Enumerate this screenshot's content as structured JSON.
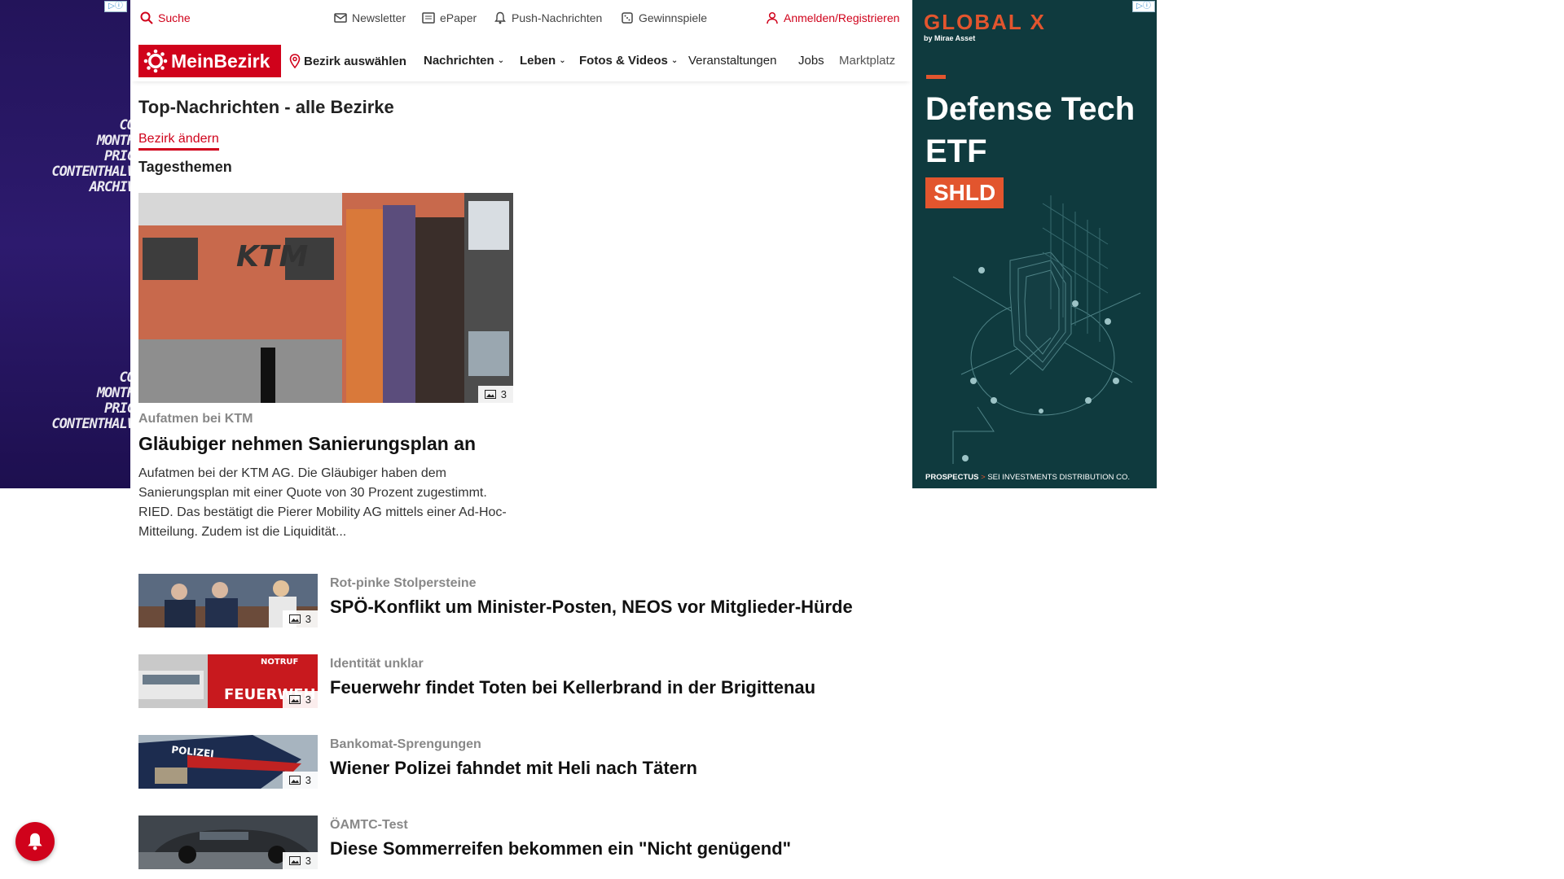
{
  "util_bar": {
    "search": "Suche",
    "newsletter": "Newsletter",
    "epaper": "ePaper",
    "push": "Push-Nachrichten",
    "contests": "Gewinnspiele",
    "login": "Anmelden/Registrieren"
  },
  "nav": {
    "logo": "MeinBezirk",
    "district": "Bezirk auswählen",
    "items": [
      {
        "label": "Nachrichten",
        "dropdown": true
      },
      {
        "label": "Leben",
        "dropdown": true
      },
      {
        "label": "Fotos & Videos",
        "dropdown": true
      },
      {
        "label": "Veranstaltungen",
        "dropdown": false
      },
      {
        "label": "Jobs",
        "dropdown": false
      },
      {
        "label": "Marktplatz",
        "dropdown": false
      }
    ]
  },
  "page": {
    "title": "Top-Nachrichten - alle Bezirke",
    "change_district": "Bezirk ändern",
    "section": "Tagesthemen"
  },
  "lead": {
    "kicker": "Aufatmen bei KTM",
    "headline": "Gläubiger nehmen Sanierungsplan an",
    "teaser": "Aufatmen bei der KTM AG. Die Gläubiger haben dem Sanierungsplan mit einer Quote von 30 Prozent zugestimmt. RIED. Das bestätigt die Pierer Mobility AG mittels einer Ad-Hoc-Mitteilung. Zudem ist die Liquidität...",
    "image_count": "3"
  },
  "articles": [
    {
      "kicker": "Rot-pinke Stolpersteine",
      "headline": "SPÖ-Konflikt um Minister-Posten, NEOS vor Mitglieder-Hürde",
      "image_count": "3"
    },
    {
      "kicker": "Identität unklar",
      "headline": "Feuerwehr findet Toten bei Kellerbrand in der Brigittenau",
      "image_count": "3"
    },
    {
      "kicker": "Bankomat-Sprengungen",
      "headline": "Wiener Polizei fahndet mit Heli nach Tätern",
      "image_count": "3"
    },
    {
      "kicker": "ÖAMTC-Test",
      "headline": "Diese Sommerreifen bekommen ein \"Nicht genügend\"",
      "image_count": "3"
    }
  ],
  "left_ad": {
    "glitch_lines_a": [
      "CO",
      "MONTH",
      "PRIC",
      "CONTENTHALV",
      "ARCHIV"
    ],
    "glitch_lines_b": [
      "CO",
      "MONTH",
      "PRIC",
      "CONTENTHALV"
    ]
  },
  "right_ad": {
    "brand": "GLOBAL X",
    "by": "by Mirae Asset",
    "title": "Defense Tech ETF",
    "ticker": "SHLD",
    "prospectus": "PROSPECTUS",
    "arrow": ">",
    "distributor": "SEI INVESTMENTS DISTRIBUTION CO."
  },
  "colors": {
    "brand_red": "#d0021b",
    "ad_teal": "#0f3a3e",
    "ad_orange": "#e2552e",
    "left_ad_purple": "#23145a"
  }
}
